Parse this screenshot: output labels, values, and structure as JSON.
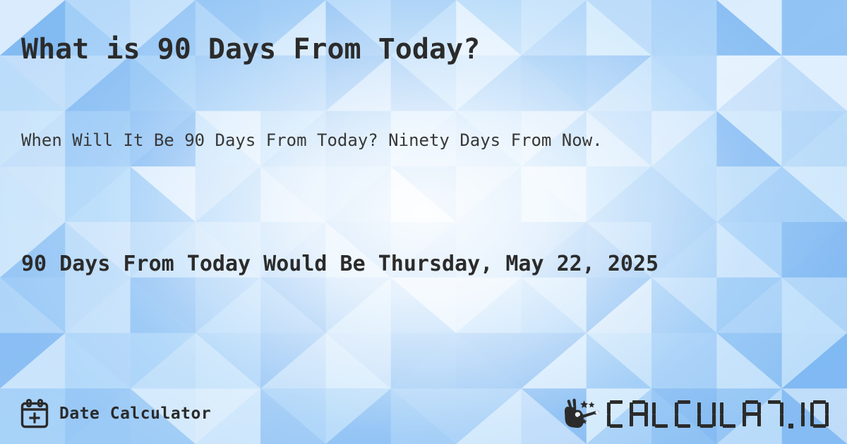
{
  "page": {
    "title": "What is 90 Days From Today?",
    "subtitle": "When Will It Be 90 Days From Today? Ninety Days From Now.",
    "answer": "90 Days From Today Would Be Thursday, May 22, 2025"
  },
  "footer": {
    "date_calculator_label": "Date Calculator",
    "calendar_icon": "calendar-plus-icon",
    "brand": {
      "wordmark": "CALCULAT.IO",
      "mark_icon": "hand-magic-wand-icon"
    }
  },
  "colors": {
    "text_primary": "#2b2b2b",
    "text_secondary": "#383838",
    "bg_blue_dark": "#7fb9f2",
    "bg_blue_mid": "#9ac8f6",
    "bg_blue_light": "#c9e1fb",
    "bg_white": "#f7fbff"
  }
}
